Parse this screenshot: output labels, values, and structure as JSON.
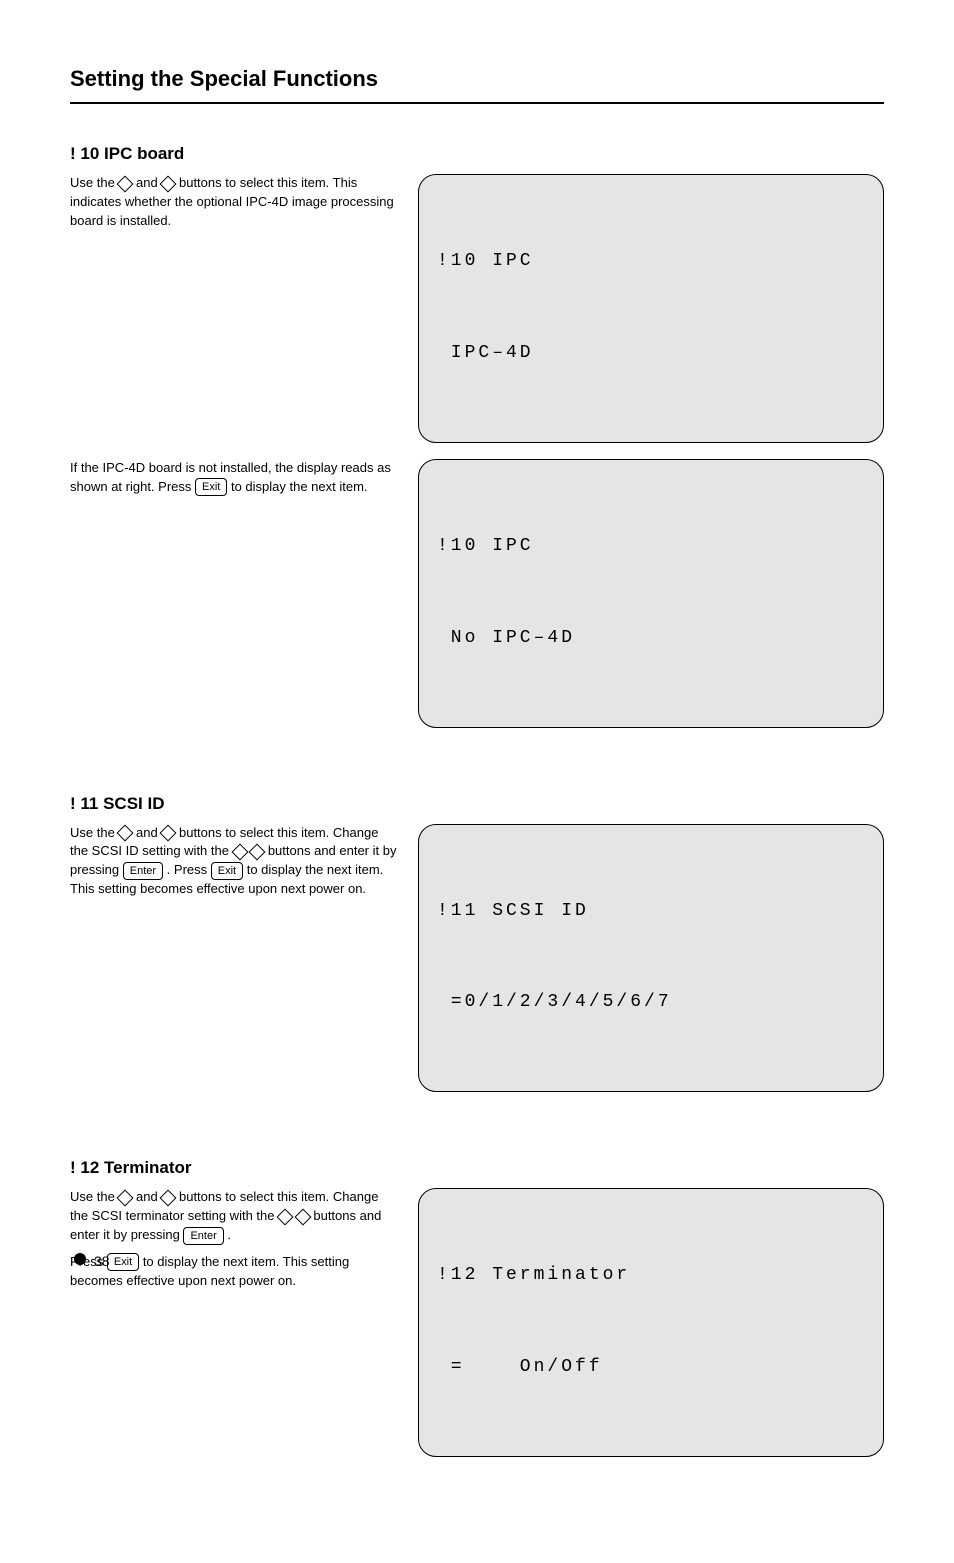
{
  "title": "Setting the Special Functions",
  "items": {
    "ipc": {
      "heading": "! 10 IPC board",
      "p1_a": "Use the ",
      "p1_b": " and ",
      "p1_c": " buttons to select this item. This indicates whether the optional IPC-4D image processing board is installed.",
      "p2_a": "If the IPC-4D board is not installed, the display reads as shown at right. Press ",
      "p2_b": " to display the next item.",
      "lcd1": {
        "l1": "!10 IPC",
        "l2": " IPC–4D"
      },
      "lcd2": {
        "l1": "!10 IPC",
        "l2": " No IPC–4D"
      }
    },
    "scsi": {
      "heading": "! 11 SCSI ID",
      "p1_a": "Use the ",
      "p1_b": " and ",
      "p1_c": " buttons to select this item. Change the SCSI ID setting with the ",
      "p1_d": " buttons and enter it by pressing ",
      "p1_e": ". Press ",
      "p1_f": " to display the next item. This setting becomes effective upon next power on.",
      "lcd": {
        "l1": "!11 SCSI ID",
        "l2": " =0/1/2/3/4/5/6/7"
      }
    },
    "term": {
      "heading": "! 12 Terminator",
      "p1_a": "Use the ",
      "p1_b": " and ",
      "p1_c": " buttons to select this item. Change the SCSI terminator setting with the ",
      "p1_d": " buttons and enter it by pressing ",
      "p1_e": ".",
      "p2_a": "Press ",
      "p2_b": " to display the next item. This setting becomes effective upon next power on.",
      "lcd": {
        "l1": "!12 Terminator",
        "l2": " =    On/Off"
      }
    }
  },
  "keys": {
    "exit": "Exit",
    "enter": "Enter"
  },
  "page_number": "38"
}
